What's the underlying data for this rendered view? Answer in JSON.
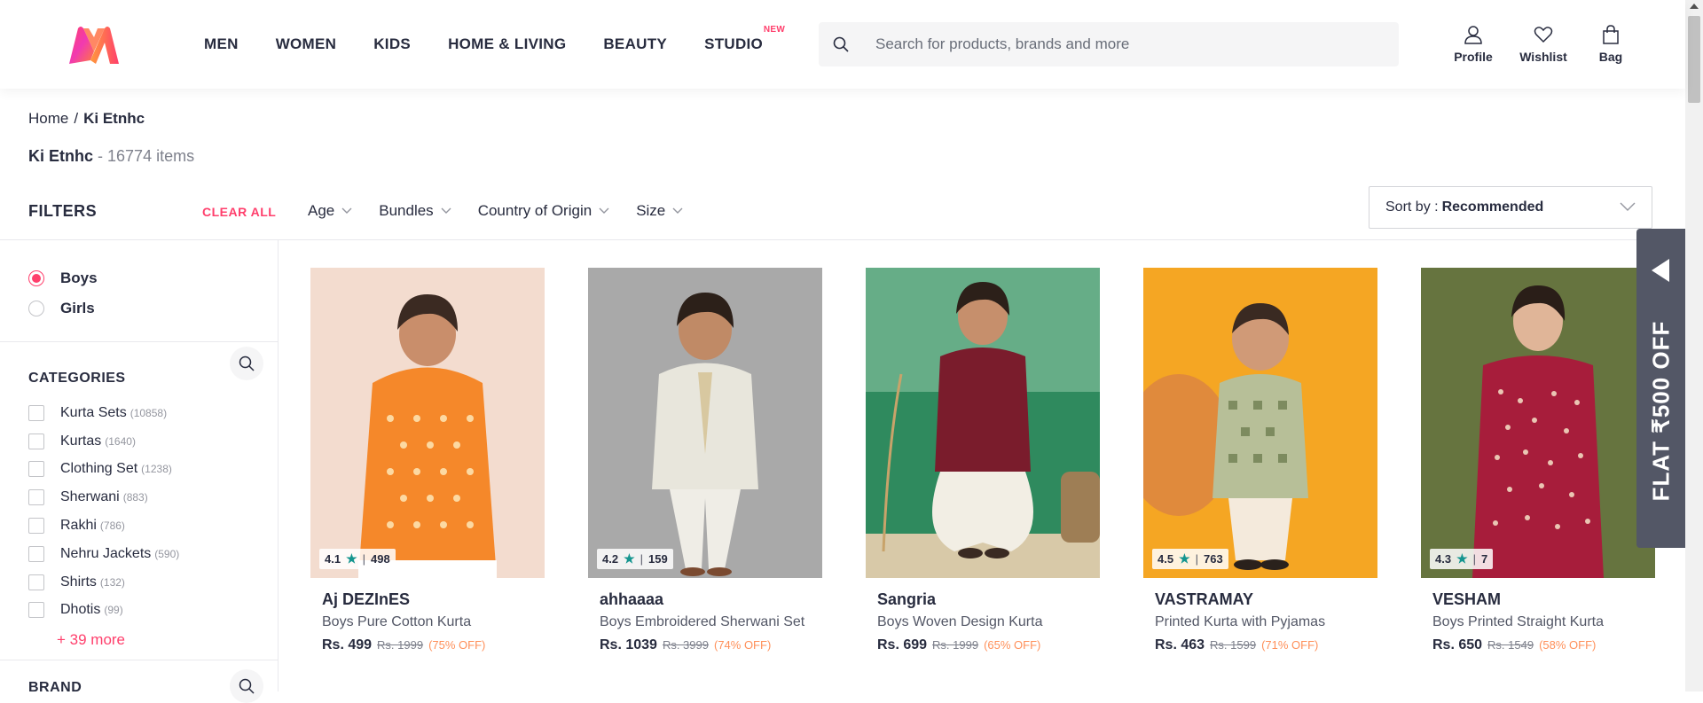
{
  "header": {
    "nav": [
      {
        "label": "MEN"
      },
      {
        "label": "WOMEN"
      },
      {
        "label": "KIDS"
      },
      {
        "label": "HOME & LIVING"
      },
      {
        "label": "BEAUTY"
      },
      {
        "label": "STUDIO",
        "badge": "NEW"
      }
    ],
    "search_placeholder": "Search for products, brands and more",
    "actions": [
      {
        "label": "Profile",
        "icon": "profile-icon"
      },
      {
        "label": "Wishlist",
        "icon": "heart-icon"
      },
      {
        "label": "Bag",
        "icon": "bag-icon"
      }
    ]
  },
  "breadcrumb": {
    "home": "Home",
    "separator": "/",
    "current": "Ki Etnhc"
  },
  "title": {
    "brand": "Ki Etnhc",
    "count": "- 16774 items"
  },
  "filters": {
    "label": "FILTERS",
    "clear_all": "CLEAR ALL",
    "chips": [
      "Age",
      "Bundles",
      "Country of Origin",
      "Size"
    ],
    "sort_prefix": "Sort by :",
    "sort_value": "Recommended"
  },
  "sidebar": {
    "gender": [
      {
        "label": "Boys",
        "selected": true
      },
      {
        "label": "Girls",
        "selected": false
      }
    ],
    "categories_title": "CATEGORIES",
    "categories": [
      {
        "label": "Kurta Sets",
        "count": "(10858)"
      },
      {
        "label": "Kurtas",
        "count": "(1640)"
      },
      {
        "label": "Clothing Set",
        "count": "(1238)"
      },
      {
        "label": "Sherwani",
        "count": "(883)"
      },
      {
        "label": "Rakhi",
        "count": "(786)"
      },
      {
        "label": "Nehru Jackets",
        "count": "(590)"
      },
      {
        "label": "Shirts",
        "count": "(132)"
      },
      {
        "label": "Dhotis",
        "count": "(99)"
      }
    ],
    "more": "+ 39 more",
    "brand_title": "BRAND"
  },
  "products": [
    {
      "brand": "Aj DEZInES",
      "name": "Boys Pure Cotton Kurta",
      "price": "Rs. 499",
      "mrp": "Rs. 1999",
      "off": "(75% OFF)",
      "rating": "4.1",
      "reviews": "498"
    },
    {
      "brand": "ahhaaaa",
      "name": "Boys Embroidered Sherwani Set",
      "price": "Rs. 1039",
      "mrp": "Rs. 3999",
      "off": "(74% OFF)",
      "rating": "4.2",
      "reviews": "159"
    },
    {
      "brand": "Sangria",
      "name": "Boys Woven Design Kurta",
      "price": "Rs. 699",
      "mrp": "Rs. 1999",
      "off": "(65% OFF)",
      "rating": "",
      "reviews": ""
    },
    {
      "brand": "VASTRAMAY",
      "name": "Printed Kurta with Pyjamas",
      "price": "Rs. 463",
      "mrp": "Rs. 1599",
      "off": "(71% OFF)",
      "rating": "4.5",
      "reviews": "763"
    },
    {
      "brand": "VESHAM",
      "name": "Boys Printed Straight Kurta",
      "price": "Rs. 650",
      "mrp": "Rs. 1549",
      "off": "(58% OFF)",
      "rating": "4.3",
      "reviews": "7"
    }
  ],
  "offer": {
    "text": "FLAT ₹500 OFF"
  },
  "colors": {
    "accent": "#ff3f6c",
    "rating_star": "#14958f",
    "discount": "#ff905a",
    "offer_bg": "#535766"
  }
}
